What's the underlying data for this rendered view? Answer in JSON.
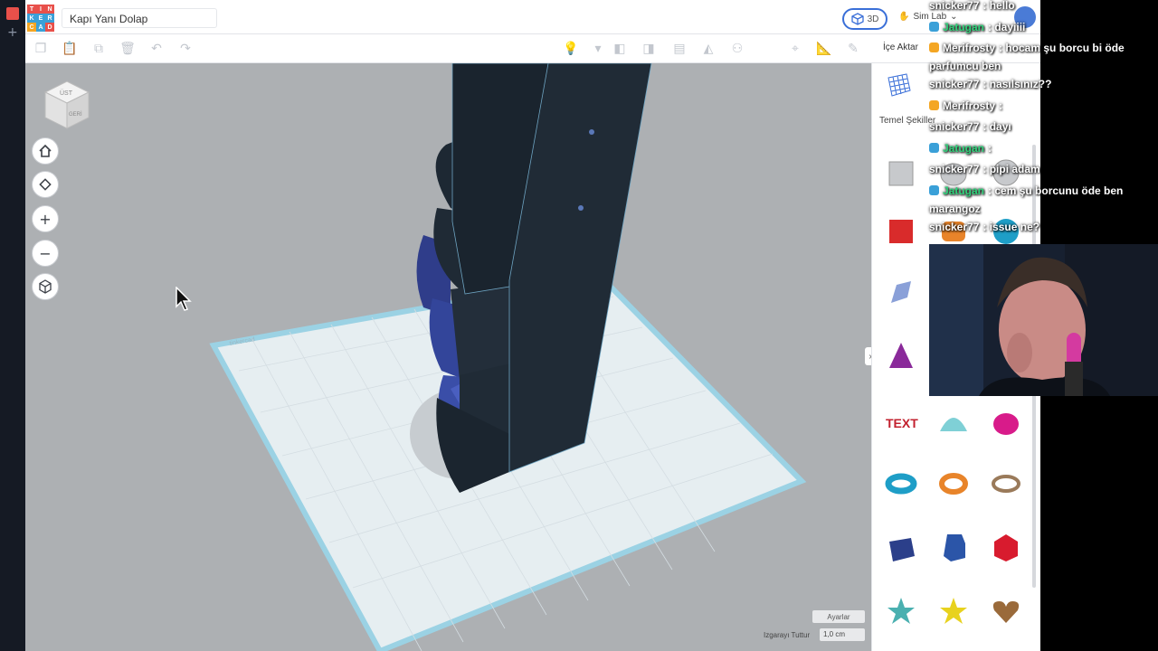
{
  "app": {
    "logo_letters": [
      "T",
      "I",
      "N",
      "K",
      "E",
      "R",
      "C",
      "A",
      "D"
    ],
    "logo_colors": [
      "#e8504a",
      "#e8504a",
      "#e8504a",
      "#3aa0d8",
      "#3aa0d8",
      "#3aa0d8",
      "#f4a623",
      "#3aa0d8",
      "#e8504a"
    ],
    "design_title": "Kapı Yanı Dolap",
    "view_toggle_label": "3D",
    "sim_lab_label": "Sim Lab",
    "accent": "#3a6fd8"
  },
  "toolbar": {
    "import_label": "İçe Aktar",
    "icons": [
      "copy-icon",
      "paste-icon",
      "duplicate-icon",
      "trash-icon",
      "undo-icon",
      "redo-icon",
      "lightbulb-icon",
      "dropdown-icon",
      "group-icon",
      "ungroup-icon",
      "align-icon",
      "mirror-icon",
      "cruise-icon",
      "workplane-icon",
      "ruler-icon",
      "note-icon"
    ]
  },
  "workplane": {
    "view_cube_top": "ÜST",
    "view_cube_front": "GERİ",
    "nav_buttons": [
      "home-view-icon",
      "fit-view-icon",
      "zoom-in-icon",
      "zoom-out-icon",
      "ortho-view-icon"
    ],
    "settings_label": "Ayarlar",
    "snap_label": "Izgarayı Tuttur",
    "snap_value": "1,0 cm",
    "plane_brand": "tinkercad"
  },
  "shapes_panel": {
    "category": "Temel Şekiller",
    "shapes": [
      {
        "name": "box-hole",
        "color": "#c7c9cc"
      },
      {
        "name": "cylinder-hole",
        "color": "#c7c9cc"
      },
      {
        "name": "sphere-hole",
        "color": "#c7c9cc"
      },
      {
        "name": "box",
        "color": "#d92b2b"
      },
      {
        "name": "cylinder",
        "color": "#e8842a"
      },
      {
        "name": "sphere",
        "color": "#1e9ec7"
      },
      {
        "name": "scribble",
        "color": "#8aa0d8"
      },
      {
        "name": "roof",
        "color": "#2e9a4a"
      },
      {
        "name": "round-roof",
        "color": "#3ab0b0"
      },
      {
        "name": "cone",
        "color": "#8a2a9a"
      },
      {
        "name": "pyramid",
        "color": "#e0c21e"
      },
      {
        "name": "wedge",
        "color": "#2a5aa8"
      },
      {
        "name": "text",
        "color": "#c2202e"
      },
      {
        "name": "half-sphere",
        "color": "#7fd0d6"
      },
      {
        "name": "paraboloid",
        "color": "#d81b8a"
      },
      {
        "name": "torus",
        "color": "#1e9ec7"
      },
      {
        "name": "tube",
        "color": "#e8842a"
      },
      {
        "name": "ring",
        "color": "#9a7a5a"
      },
      {
        "name": "hexagonal-prism",
        "color": "#2b3f8a"
      },
      {
        "name": "polygon",
        "color": "#2b55a8"
      },
      {
        "name": "icosahedron",
        "color": "#d81b2e"
      },
      {
        "name": "star",
        "color": "#4ab0b0"
      },
      {
        "name": "star-yellow",
        "color": "#e8d21e"
      },
      {
        "name": "heart",
        "color": "#9a6a3a"
      }
    ]
  },
  "chat": [
    {
      "user": "snicker77",
      "text": ": hello",
      "color": "#ffffff",
      "badge": ""
    },
    {
      "user": "Jatugan",
      "text": ": dayiiii",
      "color": "#2fd27a",
      "badge": "#3aa0d8"
    },
    {
      "user": "Merifrosty",
      "text": ": hocam şu borcu bi öde parfumcu ben",
      "color": "#ffffff",
      "badge": "#f4a623"
    },
    {
      "user": "snicker77",
      "text": ": nasılsınız??",
      "color": "#ffffff",
      "badge": ""
    },
    {
      "user": "Merifrosty",
      "text": ":",
      "color": "#ffffff",
      "badge": "#f4a623"
    },
    {
      "user": "snicker77",
      "text": ": dayı",
      "color": "#ffffff",
      "badge": ""
    },
    {
      "user": "Jatugan",
      "text": ": ",
      "color": "#2fd27a",
      "badge": "#3aa0d8"
    },
    {
      "user": "snicker77",
      "text": ": pipi adam",
      "color": "#ffffff",
      "badge": ""
    },
    {
      "user": "Jatugan",
      "text": ": cem şu borcunu öde ben marangoz",
      "color": "#2fd27a",
      "badge": "#3aa0d8"
    },
    {
      "user": "snicker77",
      "text": ": issue ne?",
      "color": "#ffffff",
      "badge": ""
    }
  ]
}
